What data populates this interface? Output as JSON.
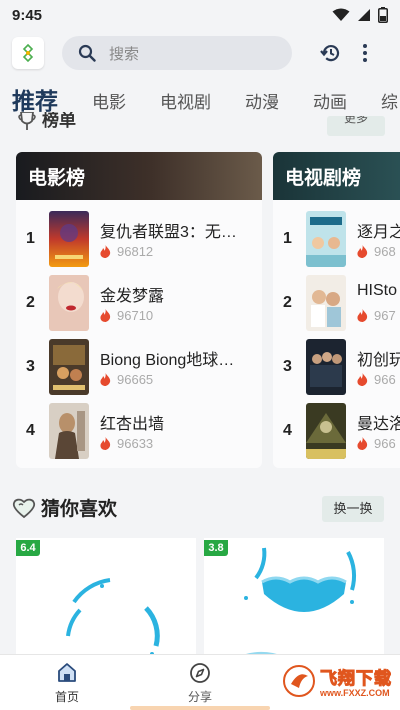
{
  "status_bar": {
    "time": "9:45",
    "icons": [
      "wifi-icon",
      "signal-icon",
      "battery-icon"
    ]
  },
  "header": {
    "logo_icon": "app-logo",
    "search_placeholder": "搜索",
    "search_icon": "search-icon",
    "history_icon": "history-icon",
    "more_icon": "more-vert-icon"
  },
  "tabs": [
    {
      "label": "推荐",
      "active": true
    },
    {
      "label": "电影",
      "active": false
    },
    {
      "label": "电视剧",
      "active": false
    },
    {
      "label": "动漫",
      "active": false
    },
    {
      "label": "动画",
      "active": false
    },
    {
      "label": "综",
      "active": false
    }
  ],
  "rankings": {
    "section_title": "榜单",
    "section_icon": "trophy-icon",
    "more_label": "更多",
    "cards": [
      {
        "title": "电影榜",
        "items": [
          {
            "rank": "1",
            "title": "复仇者联盟3：无…",
            "heat": "96812"
          },
          {
            "rank": "2",
            "title": "金发梦露",
            "heat": "96710"
          },
          {
            "rank": "3",
            "title": "Biong Biong地球…",
            "heat": "96665"
          },
          {
            "rank": "4",
            "title": "红杏出墙",
            "heat": "96633"
          }
        ]
      },
      {
        "title": "电视剧榜",
        "items": [
          {
            "rank": "1",
            "title": "逐月之",
            "heat": "968"
          },
          {
            "rank": "2",
            "title": "HISto",
            "heat": "967"
          },
          {
            "rank": "3",
            "title": "初创玩",
            "heat": "966"
          },
          {
            "rank": "4",
            "title": "曼达洛",
            "heat": "966"
          }
        ]
      }
    ]
  },
  "guess": {
    "title": "猜你喜欢",
    "icon": "heart-icon",
    "swap_label": "换一换",
    "cards": [
      {
        "score": "6.4"
      },
      {
        "score": "3.8"
      }
    ]
  },
  "bottom_nav": [
    {
      "label": "首页",
      "icon": "home-icon",
      "active": true
    },
    {
      "label": "分享",
      "icon": "compass-icon",
      "active": false
    }
  ],
  "watermark": {
    "main": "飞翔下载",
    "sub": "www.FXXZ.COM"
  },
  "colors": {
    "heat": "#e64a2e",
    "score_badge": "#27a843",
    "accent_blue": "#1f3a5c",
    "teal_loader": "#2bb3e0"
  }
}
